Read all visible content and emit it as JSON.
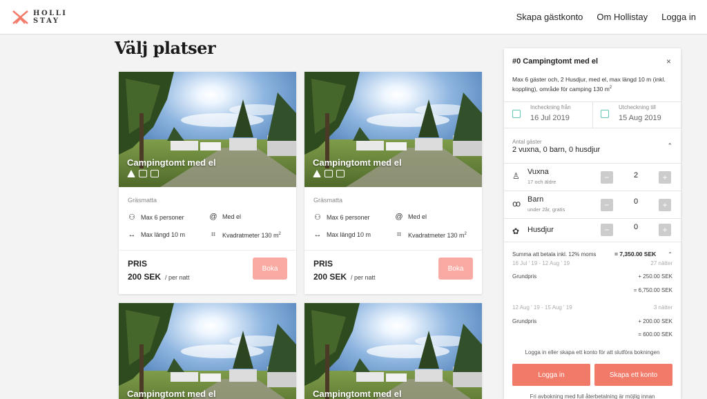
{
  "header": {
    "logo_line1": "HOLLI",
    "logo_line2": "STAY",
    "nav": [
      "Skapa gästkonto",
      "Om Hollistay",
      "Logga in"
    ]
  },
  "page_title": "Välj platser",
  "cards": [
    {
      "image_title": "Campingtomt med el",
      "surface": "Gräsmatta",
      "features": {
        "guests": "Max 6 personer",
        "electricity": "Med el",
        "length": "Max längd 10 m",
        "area": "Kvadratmeter 130 m",
        "area_sup": "2"
      },
      "price_label": "PRIS",
      "price_value": "200 SEK",
      "price_unit": "/ per natt",
      "book_label": "Boka"
    },
    {
      "image_title": "Campingtomt med el",
      "surface": "Gräsmatta",
      "features": {
        "guests": "Max 6 personer",
        "electricity": "Med el",
        "length": "Max längd 10 m",
        "area": "Kvadratmeter 130 m",
        "area_sup": "2"
      },
      "price_label": "PRIS",
      "price_value": "200 SEK",
      "price_unit": "/ per natt",
      "book_label": "Boka"
    },
    {
      "image_title": "Campingtomt med el"
    },
    {
      "image_title": "Campingtomt med el"
    }
  ],
  "panel": {
    "title": "#0 Campingtomt med el",
    "close": "×",
    "description": "Max 6 gäster och,  2 Husdjur,  med el,  max längd 10 m (inkl. koppling),  område för camping 130 m",
    "description_sup": "2",
    "checkin_label": "Incheckning från",
    "checkin_value": "16 Jul 2019",
    "checkout_label": "Utcheckning till",
    "checkout_value": "15 Aug 2019",
    "guests_label": "Antal gäster",
    "guests_value": "2 vuxna,  0 barn,  0 husdjur",
    "rows": [
      {
        "name": "Vuxna",
        "sub": "17 och äldre",
        "count": "2",
        "minus": "−",
        "plus": "+"
      },
      {
        "name": "Barn",
        "sub": "under 2år, gratis",
        "count": "0",
        "minus": "−",
        "plus": "+"
      },
      {
        "name": "Husdjur",
        "sub": "",
        "count": "0",
        "minus": "−",
        "plus": "+"
      }
    ],
    "summary_label": "Summa att betala inkl. 12% moms",
    "summary_value": "= 7,350.00 SEK",
    "period1": "16 Jul ' 19 - 12 Aug ' 19",
    "period1_nights": "27 nätter",
    "base_label_1": "Grundpris",
    "period1_rate": "+ 250.00 SEK",
    "period1_total": "= 6,750.00 SEK",
    "period2": "12 Aug ' 19 - 15 Aug ' 19",
    "period2_nights": "3 nätter",
    "base_label_2": "Grundpris",
    "period2_rate": "+ 200.00 SEK",
    "period2_total": "= 600.00 SEK",
    "login_note": "Logga in eller skapa ett konto för att slutföra bokningen",
    "login_button": "Logga in",
    "create_button": "Skapa ett konto",
    "footer_note": "Fri avbokning med full återbetalning är möjlig innan"
  },
  "colors": {
    "accent": "#f27a69",
    "accent_light": "#f9aaa2",
    "calendar": "#5fc7b8"
  }
}
